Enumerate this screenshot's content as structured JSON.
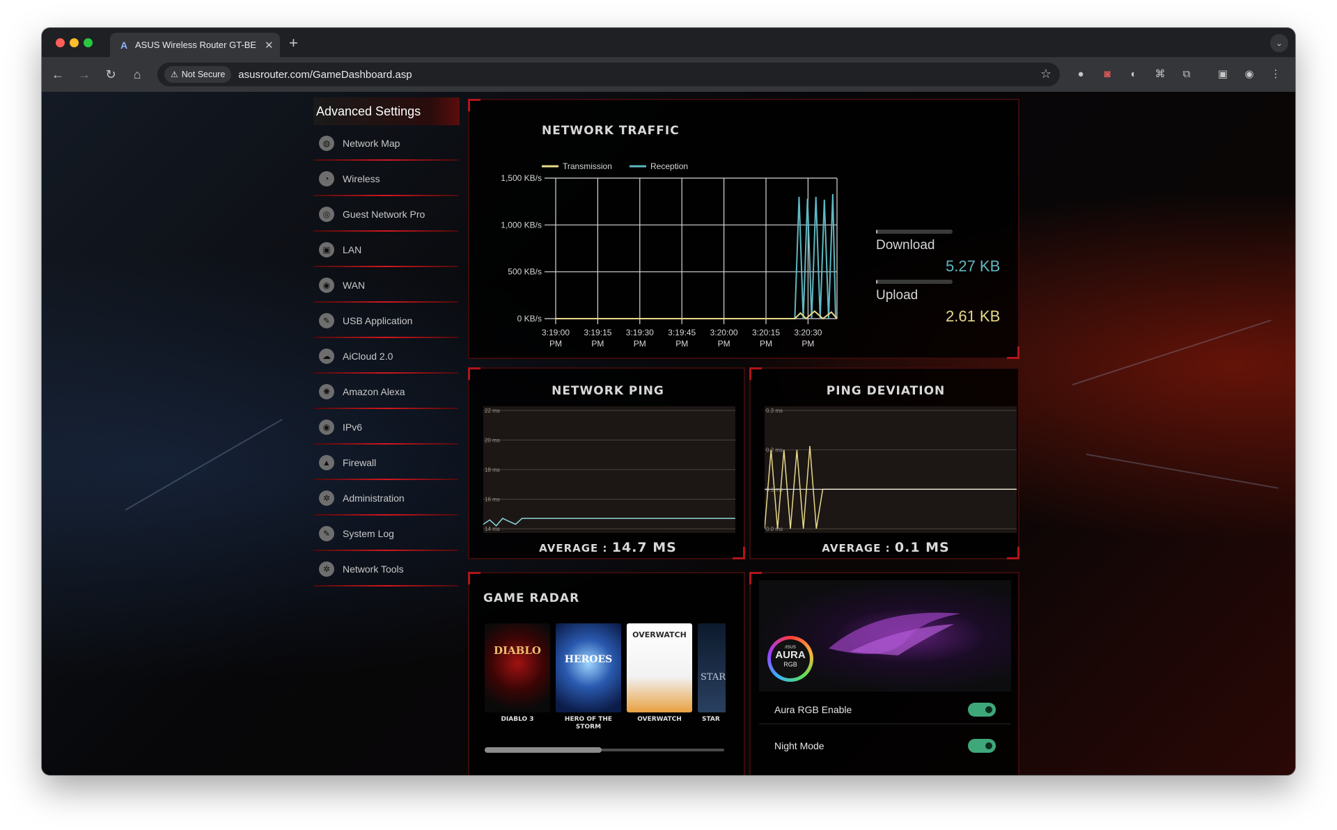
{
  "browser": {
    "tab_title": "ASUS Wireless Router GT-BE",
    "tab_logo": "A",
    "security_label": "Not Secure",
    "url": "asusrouter.com/GameDashboard.asp"
  },
  "sidebar": {
    "title": "Advanced Settings",
    "items": [
      {
        "label": "Network Map",
        "icon": "network-map-icon"
      },
      {
        "label": "Wireless",
        "icon": "wireless-icon"
      },
      {
        "label": "Guest Network Pro",
        "icon": "guest-network-icon"
      },
      {
        "label": "LAN",
        "icon": "lan-icon"
      },
      {
        "label": "WAN",
        "icon": "wan-globe-icon"
      },
      {
        "label": "USB Application",
        "icon": "usb-icon"
      },
      {
        "label": "AiCloud 2.0",
        "icon": "cloud-icon"
      },
      {
        "label": "Amazon Alexa",
        "icon": "alexa-icon"
      },
      {
        "label": "IPv6",
        "icon": "ipv6-globe-icon"
      },
      {
        "label": "Firewall",
        "icon": "firewall-icon"
      },
      {
        "label": "Administration",
        "icon": "gear-icon"
      },
      {
        "label": "System Log",
        "icon": "log-icon"
      },
      {
        "label": "Network Tools",
        "icon": "tools-icon"
      }
    ]
  },
  "traffic": {
    "title": "NETWORK TRAFFIC",
    "legend_tx": "Transmission",
    "legend_rx": "Reception",
    "download_label": "Download",
    "download_value": "5.27 KB",
    "upload_label": "Upload",
    "upload_value": "2.61 KB",
    "download_level": 0.02,
    "upload_level": 0.02,
    "colors": {
      "tx": "#e8d98a",
      "rx": "#5fb8c2"
    }
  },
  "ping": {
    "title": "NETWORK PING",
    "avg_label": "AVERAGE :",
    "avg_value": "14.7 MS"
  },
  "deviation": {
    "title": "PING DEVIATION",
    "avg_label": "AVERAGE :",
    "avg_value": "0.1 MS"
  },
  "radar": {
    "title": "GAME RADAR",
    "games": [
      {
        "label": "DIABLO 3",
        "cover_text": "DIABLO"
      },
      {
        "label": "HERO OF THE STORM",
        "cover_text": "HEROES"
      },
      {
        "label": "OVERWATCH",
        "cover_text": "OVERWATCH"
      },
      {
        "label": "STAR",
        "cover_text": "STAR"
      }
    ],
    "scroll_position": 0.0
  },
  "aura": {
    "logo_top": "/ISUS",
    "logo_main": "AURA",
    "logo_sub": "RGB",
    "enable_label": "Aura RGB Enable",
    "night_label": "Night Mode",
    "enable_on": true,
    "night_on": true
  },
  "chart_data": [
    {
      "type": "line",
      "title": "NETWORK TRAFFIC",
      "x": [
        "3:19:00 PM",
        "3:19:15 PM",
        "3:19:30 PM",
        "3:19:45 PM",
        "3:20:00 PM",
        "3:20:15 PM",
        "3:20:30 PM"
      ],
      "ylabels": [
        "0 KB/s",
        "500 KB/s",
        "1,000 KB/s",
        "1,500 KB/s"
      ],
      "ylim": [
        0,
        1500
      ],
      "xlim_seconds": [
        0,
        100
      ],
      "grid": true,
      "legend": "top-left",
      "series": [
        {
          "name": "Reception",
          "points": [
            [
              0,
              0
            ],
            [
              85,
              0
            ],
            [
              86.5,
              1300
            ],
            [
              88,
              0
            ],
            [
              89.5,
              1280
            ],
            [
              91,
              0
            ],
            [
              92.5,
              1300
            ],
            [
              94,
              0
            ],
            [
              95.5,
              1270
            ],
            [
              97,
              0
            ],
            [
              98.5,
              1330
            ],
            [
              99.5,
              0
            ]
          ]
        },
        {
          "name": "Transmission",
          "points": [
            [
              0,
              0
            ],
            [
              85,
              0
            ],
            [
              87,
              60
            ],
            [
              89,
              0
            ],
            [
              92,
              80
            ],
            [
              95,
              0
            ],
            [
              98,
              70
            ],
            [
              100,
              0
            ]
          ]
        }
      ]
    },
    {
      "type": "line",
      "title": "NETWORK PING",
      "ylabels": [
        "14 ms",
        "16 ms",
        "18 ms",
        "20 ms",
        "22 ms"
      ],
      "ylim": [
        14,
        22
      ],
      "grid": true,
      "series": [
        {
          "name": "",
          "values": [
            14.3,
            14.6,
            14.2,
            14.7,
            14.5,
            14.3,
            14.7,
            14.7,
            14.7,
            14.7,
            14.7,
            14.7,
            14.7,
            14.7,
            14.7,
            14.7,
            14.7,
            14.7,
            14.7,
            14.7,
            14.7,
            14.7,
            14.7,
            14.7,
            14.7,
            14.7,
            14.7,
            14.7,
            14.7,
            14.7,
            14.7,
            14.7,
            14.7,
            14.7,
            14.7,
            14.7,
            14.7,
            14.7,
            14.7,
            14.7
          ]
        }
      ]
    },
    {
      "type": "line",
      "title": "PING DEVIATION",
      "ylabels": [
        "0.0 ms",
        "0.1 ms",
        "0.2 ms",
        "0.3 ms"
      ],
      "ylim": [
        0,
        0.3
      ],
      "grid": true,
      "series": [
        {
          "name": "",
          "values": [
            0.0,
            0.2,
            0.0,
            0.2,
            0.0,
            0.2,
            0.0,
            0.21,
            0.0,
            0.1,
            0.1,
            0.1,
            0.1,
            0.1,
            0.1,
            0.1,
            0.1,
            0.1,
            0.1,
            0.1,
            0.1,
            0.1,
            0.1,
            0.1,
            0.1,
            0.1,
            0.1,
            0.1,
            0.1,
            0.1,
            0.1,
            0.1,
            0.1,
            0.1,
            0.1,
            0.1,
            0.1,
            0.1,
            0.1,
            0.1
          ]
        }
      ]
    }
  ]
}
